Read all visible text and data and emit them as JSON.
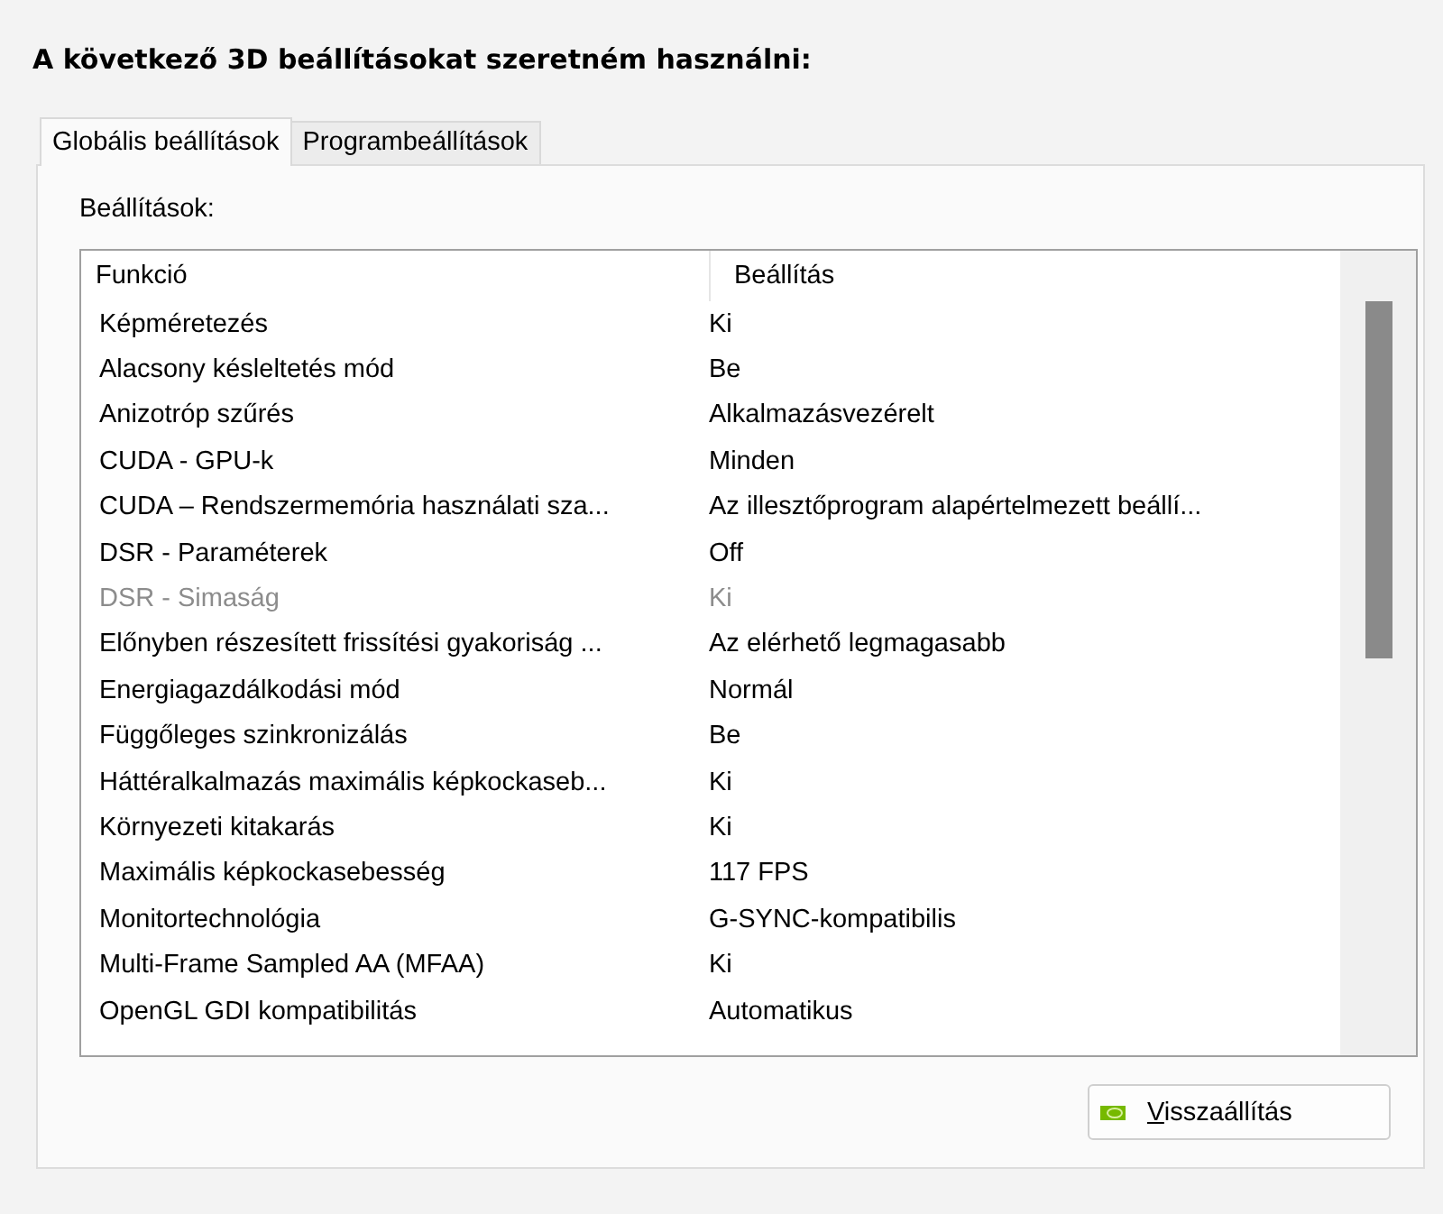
{
  "heading": "A következő 3D beállításokat szeretném használni:",
  "tabs": [
    {
      "label": "Globális beállítások",
      "selected": true
    },
    {
      "label": "Programbeállítások",
      "selected": false
    }
  ],
  "settings_label": "Beállítások:",
  "table": {
    "columns": [
      "Funkció",
      "Beállítás"
    ],
    "rows": [
      {
        "feature": "Képméretezés",
        "value": "Ki",
        "disabled": false
      },
      {
        "feature": "Alacsony késleltetés mód",
        "value": "Be",
        "disabled": false
      },
      {
        "feature": "Anizotróp szűrés",
        "value": "Alkalmazásvezérelt",
        "disabled": false
      },
      {
        "feature": "CUDA - GPU-k",
        "value": "Minden",
        "disabled": false
      },
      {
        "feature": "CUDA – Rendszermemória használati sza...",
        "value": "Az illesztőprogram alapértelmezett beállí...",
        "disabled": false
      },
      {
        "feature": "DSR - Paraméterek",
        "value": "Off",
        "disabled": false
      },
      {
        "feature": "DSR - Simaság",
        "value": "Ki",
        "disabled": true
      },
      {
        "feature": "Előnyben részesített frissítési gyakoriság ...",
        "value": "Az elérhető legmagasabb",
        "disabled": false
      },
      {
        "feature": "Energiagazdálkodási mód",
        "value": "Normál",
        "disabled": false
      },
      {
        "feature": "Függőleges szinkronizálás",
        "value": "Be",
        "disabled": false
      },
      {
        "feature": "Háttéralkalmazás maximális képkockaseb...",
        "value": "Ki",
        "disabled": false
      },
      {
        "feature": "Környezeti kitakarás",
        "value": "Ki",
        "disabled": false
      },
      {
        "feature": "Maximális képkockasebesség",
        "value": "117 FPS",
        "disabled": false
      },
      {
        "feature": "Monitortechnológia",
        "value": "G-SYNC-kompatibilis",
        "disabled": false
      },
      {
        "feature": "Multi-Frame Sampled AA (MFAA)",
        "value": "Ki",
        "disabled": false
      },
      {
        "feature": "OpenGL GDI kompatibilitás",
        "value": "Automatikus",
        "disabled": false
      }
    ]
  },
  "restore_button": {
    "label": "Visszaállítás"
  }
}
